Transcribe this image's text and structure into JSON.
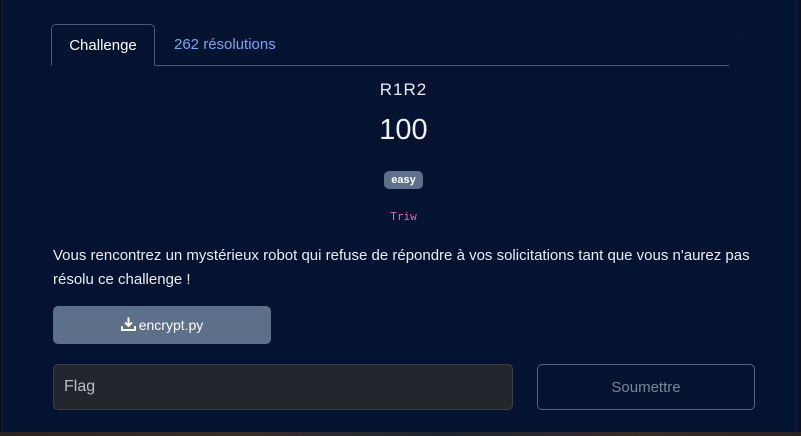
{
  "modal": {
    "close_symbol": "×",
    "tabs": [
      {
        "label": "Challenge",
        "active": true
      },
      {
        "label": "262 résolutions",
        "active": false
      }
    ]
  },
  "challenge": {
    "name": "R1R2",
    "points": "100",
    "difficulty": "easy",
    "author": "Triw",
    "description": "Vous rencontrez un mystérieux robot qui refuse de répondre à vos solicitations tant que vous n'aurez pas résolu ce challenge !"
  },
  "file": {
    "icon": "download-icon",
    "label": "encrypt.py"
  },
  "form": {
    "flag_placeholder": "Flag",
    "submit_label": "Soumettre"
  },
  "colors": {
    "modal_background": "#031330",
    "tab_link": "#76a3f0",
    "badge": "#5d718c",
    "author": "#e66fb0",
    "download_button": "#5c7089"
  }
}
